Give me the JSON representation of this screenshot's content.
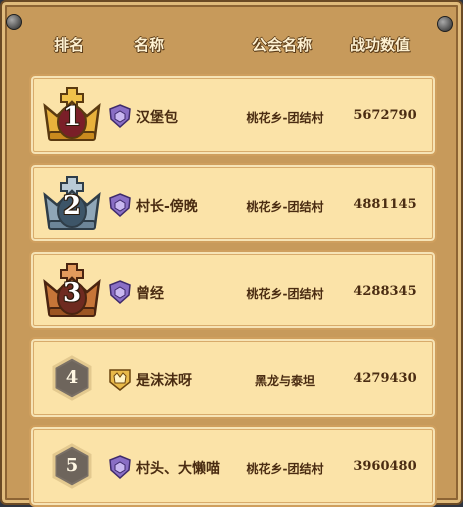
{
  "header": {
    "rank": "排名",
    "name": "名称",
    "guild": "公会名称",
    "power": "战功数值"
  },
  "rows": [
    {
      "rank": "1",
      "badge": "gold-crown-icon",
      "crown_color": "#e8b23c",
      "guild_icon": "purple-guild-shield-icon",
      "name": "汉堡包",
      "guild": "桃花乡-团结村",
      "power": "5672790"
    },
    {
      "rank": "2",
      "badge": "silver-crown-icon",
      "crown_color": "#8fa6b7",
      "guild_icon": "purple-guild-shield-icon",
      "name": "村长-傍晚",
      "guild": "桃花乡-团结村",
      "power": "4881145"
    },
    {
      "rank": "3",
      "badge": "bronze-crown-icon",
      "crown_color": "#c67538",
      "guild_icon": "purple-guild-shield-icon",
      "name": "曾经",
      "guild": "桃花乡-团结村",
      "power": "4288345"
    },
    {
      "rank": "4",
      "badge": "hexagon-rank-icon",
      "crown_color": "#6e655c",
      "guild_icon": "gold-guild-shield-icon",
      "name": "是沫沫呀",
      "guild": "黑龙与泰坦",
      "power": "4279430"
    },
    {
      "rank": "5",
      "badge": "hexagon-rank-icon",
      "crown_color": "#6e655c",
      "guild_icon": "purple-guild-shield-icon",
      "name": "村头、大懒喵",
      "guild": "桃花乡-团结村",
      "power": "3960480"
    }
  ]
}
